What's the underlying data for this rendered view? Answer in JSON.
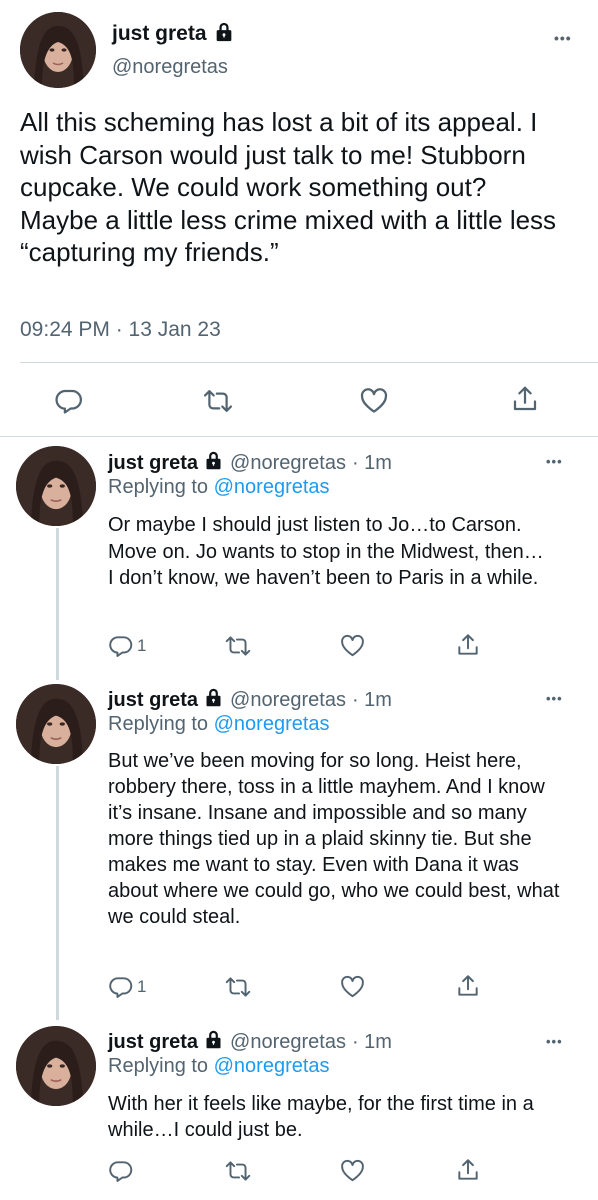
{
  "main_tweet": {
    "display_name": "just greta",
    "handle": "@noregretas",
    "text": "All this scheming has lost a bit of its appeal. I wish Carson would just talk to me! Stubborn cupcake. We could work something out? Maybe a little less crime mixed with a little less “capturing my friends.”",
    "timestamp": "09:24 PM · 13 Jan 23",
    "more_label": "•••"
  },
  "replies": [
    {
      "display_name": "just greta",
      "handle": "@noregretas",
      "time": "· 1m",
      "replying_prefix": "Replying to ",
      "replying_to": "@noregretas",
      "text": "Or maybe I should just listen to Jo…to Carson. Move on. Jo wants to stop in the Midwest, then…I don’t know, we haven’t been to Paris in a while.",
      "reply_count": "1",
      "more_label": "•••"
    },
    {
      "display_name": "just greta",
      "handle": "@noregretas",
      "time": "· 1m",
      "replying_prefix": "Replying to ",
      "replying_to": "@noregretas",
      "text": "But we’ve been moving for so long. Heist here, robbery there, toss in a little mayhem. And I know it’s insane. Insane and impossible and so many more things tied up in a plaid skinny tie. But she makes me want to stay. Even with Dana it was about where we could go, who we could best, what we could steal.",
      "reply_count": "1",
      "more_label": "•••"
    },
    {
      "display_name": "just greta",
      "handle": "@noregretas",
      "time": "· 1m",
      "replying_prefix": "Replying to ",
      "replying_to": "@noregretas",
      "text": "With her it feels like maybe, for the first time in a while…I could just be.",
      "reply_count": "",
      "more_label": "•••"
    }
  ],
  "icons": {
    "lock": "lock-icon",
    "reply": "reply-icon",
    "retweet": "retweet-icon",
    "like": "heart-icon",
    "share": "share-icon"
  },
  "colors": {
    "text": "#0f1419",
    "secondary": "#536471",
    "link": "#1d9bf0",
    "divider": "#cfd9de"
  }
}
